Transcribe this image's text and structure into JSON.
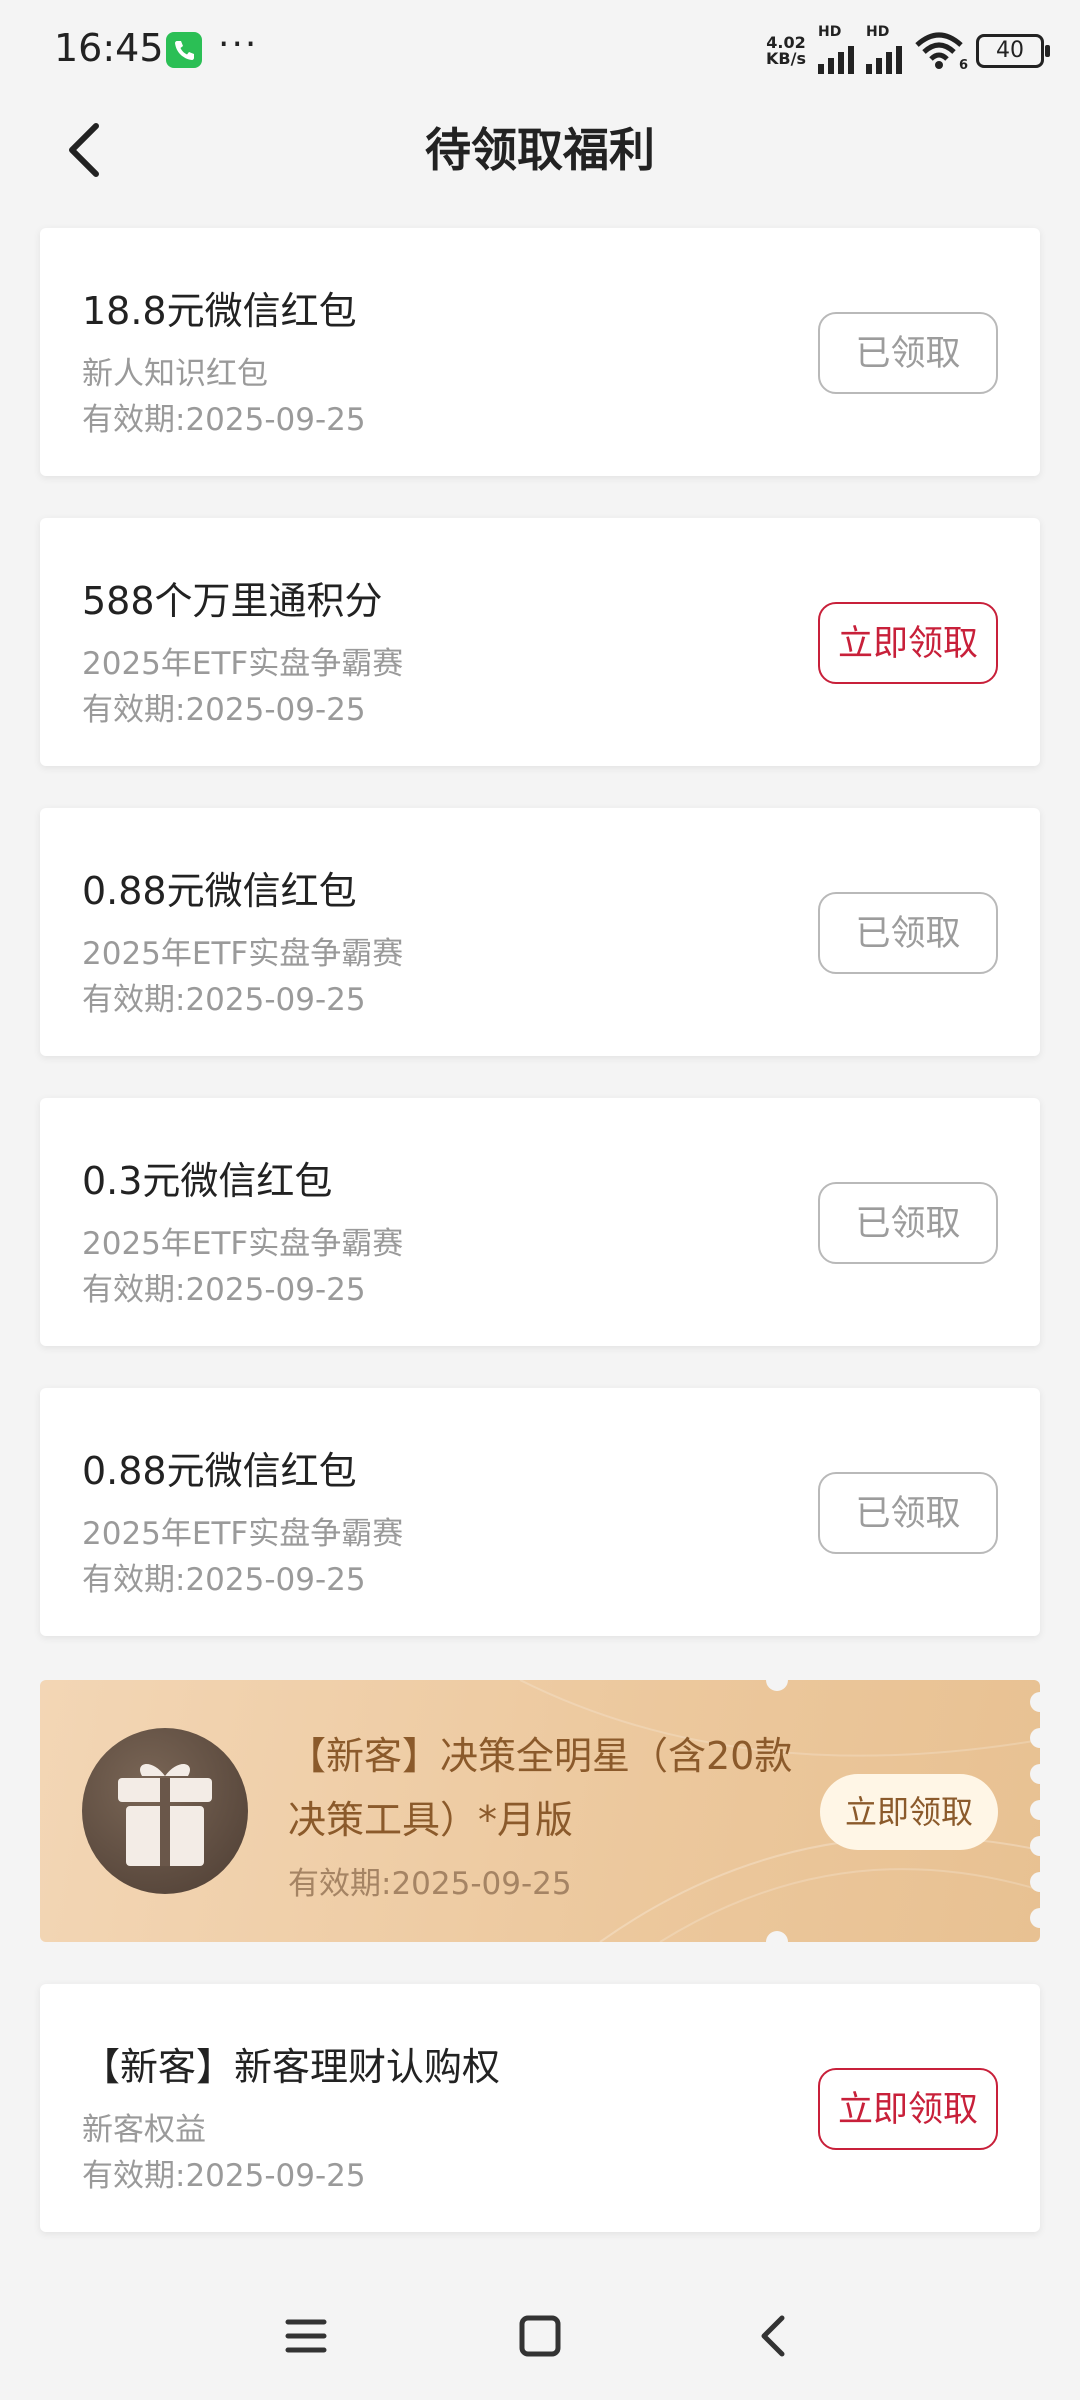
{
  "status_bar": {
    "time": "16:45",
    "dots": "···",
    "speed_value": "4.02",
    "speed_unit": "KB/s",
    "network_1": "HD",
    "network_2": "HD",
    "wifi_badge": "6",
    "battery": "40"
  },
  "header": {
    "title": "待领取福利",
    "back_icon": "chevron-left-icon"
  },
  "cards": [
    {
      "title": "18.8元微信红包",
      "subtitle": "新人知识红包",
      "expiry": "有效期:2025-09-25",
      "button": "已领取",
      "state": "claimed"
    },
    {
      "title": "588个万里通积分",
      "subtitle": "2025年ETF实盘争霸赛",
      "expiry": "有效期:2025-09-25",
      "button": "立即领取",
      "state": "claim"
    },
    {
      "title": "0.88元微信红包",
      "subtitle": "2025年ETF实盘争霸赛",
      "expiry": "有效期:2025-09-25",
      "button": "已领取",
      "state": "claimed"
    },
    {
      "title": "0.3元微信红包",
      "subtitle": "2025年ETF实盘争霸赛",
      "expiry": "有效期:2025-09-25",
      "button": "已领取",
      "state": "claimed"
    },
    {
      "title": "0.88元微信红包",
      "subtitle": "2025年ETF实盘争霸赛",
      "expiry": "有效期:2025-09-25",
      "button": "已领取",
      "state": "claimed"
    }
  ],
  "promo": {
    "title": "【新客】决策全明星（含20款决策工具）*月版",
    "expiry": "有效期:2025-09-25",
    "button": "立即领取",
    "icon": "gift-icon"
  },
  "last_card": {
    "title": "【新客】新客理财认购权",
    "subtitle": "新客权益",
    "expiry": "有效期:2025-09-25",
    "button": "立即领取"
  },
  "colors": {
    "accent_red": "#c8203a",
    "promo_gold": "#ecc89d",
    "promo_text": "#8b5a2b"
  },
  "nav_bar": [
    "menu-icon",
    "home-icon",
    "back-icon"
  ]
}
